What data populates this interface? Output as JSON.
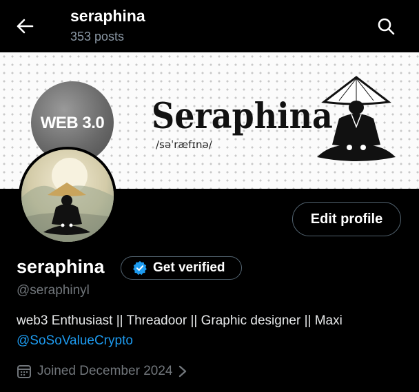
{
  "header": {
    "title": "seraphina",
    "post_count": "353 posts",
    "back_icon": "arrow-left-icon",
    "search_icon": "search-icon"
  },
  "banner": {
    "badge_text": "WEB 3.0",
    "brand_name": "Seraphina",
    "phonetic": "/səˈræfɪnə/"
  },
  "profile": {
    "name": "seraphina",
    "verify_label": "Get verified",
    "handle": "@seraphinyl",
    "bio": "web3 Enthusiast || Threadoor || Graphic designer || Maxi",
    "mention": "@SoSoValueCrypto",
    "joined": "Joined December 2024",
    "edit_label": "Edit profile"
  },
  "colors": {
    "background": "#000000",
    "link": "#1d9bf0",
    "secondary_text": "#71767b",
    "verified_badge": "#1d9bf0"
  }
}
